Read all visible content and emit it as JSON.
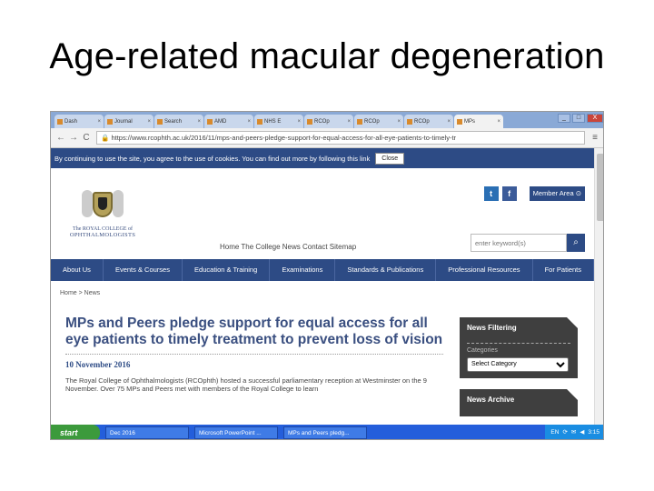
{
  "slide": {
    "title": "Age-related macular degeneration"
  },
  "browser": {
    "tabs": [
      {
        "label": "Dash"
      },
      {
        "label": "Journal"
      },
      {
        "label": "Search"
      },
      {
        "label": "AMD"
      },
      {
        "label": "NHS E"
      },
      {
        "label": "RCOp"
      },
      {
        "label": "RCOp"
      },
      {
        "label": "RCOp"
      },
      {
        "label": "MPs"
      }
    ],
    "window_buttons": {
      "minimize": "_",
      "maximize": "□",
      "close": "X"
    },
    "back": "←",
    "forward": "→",
    "reload": "C",
    "url": "https://www.rcophth.ac.uk/2016/11/mps-and-peers-pledge-support-for-equal-access-for-all-eye-patients-to-timely-tr",
    "menu": "≡"
  },
  "page": {
    "cookie_text": "By continuing to use the site, you agree to the use of cookies. You can find out more by following this link",
    "cookie_close": "Close",
    "logo_line1": "The ROYAL COLLEGE of",
    "logo_line2": "OPHTHALMOLOGISTS",
    "twitter": "t",
    "facebook": "f",
    "member_area": "Member Area ⊙",
    "top_links": "Home  The College  News  Contact  Sitemap",
    "search_placeholder": "enter keyword(s)",
    "search_btn": "⌕",
    "nav": [
      "About Us",
      "Events & Courses",
      "Education & Training",
      "Examinations",
      "Standards & Publications",
      "Professional Resources",
      "For Patients"
    ],
    "breadcrumb": "Home > News",
    "headline": "MPs and Peers pledge support for equal access for all eye patients to timely treatment to prevent loss of vision",
    "date": "10 November 2016",
    "para": "The Royal College of Ophthalmologists (RCOphth) hosted a successful parliamentary reception at Westminster on the 9 November. Over 75 MPs and Peers met with members of the Royal College to learn",
    "news_filtering": "News Filtering",
    "categories_label": "Categories",
    "select_category": "Select Category",
    "news_archive": "News Archive"
  },
  "taskbar": {
    "start": "start",
    "tasks": [
      "Dec 2016",
      "Microsoft PowerPoint ...",
      "MPs and Peers pledg..."
    ],
    "tray": [
      "EN",
      "⟳",
      "✉",
      "◀",
      "3:15"
    ]
  }
}
